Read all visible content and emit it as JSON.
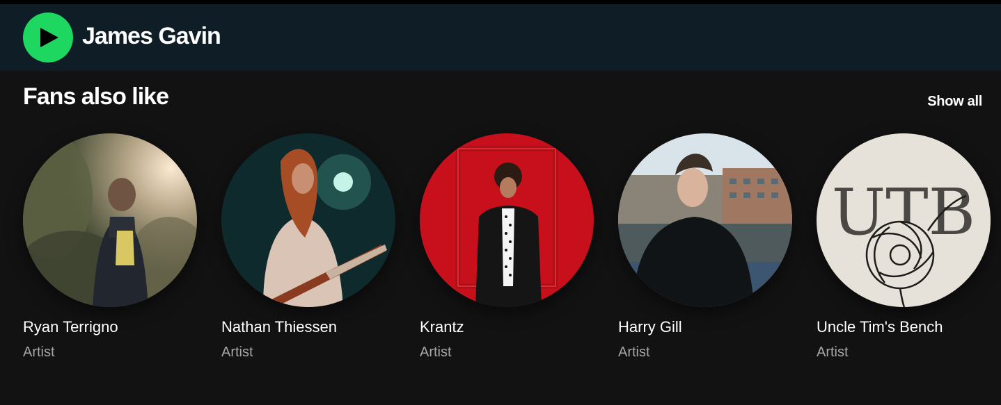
{
  "header": {
    "play_icon": "play-icon",
    "artist_name": "James Gavin",
    "play_color": "#1ed760"
  },
  "section": {
    "title": "Fans also like",
    "show_all": "Show all"
  },
  "artists": [
    {
      "name": "Ryan Terrigno",
      "type": "Artist"
    },
    {
      "name": "Nathan Thiessen",
      "type": "Artist"
    },
    {
      "name": "Krantz",
      "type": "Artist"
    },
    {
      "name": "Harry Gill",
      "type": "Artist"
    },
    {
      "name": "Uncle Tim's Bench",
      "type": "Artist",
      "logo_text": "UTB"
    }
  ]
}
